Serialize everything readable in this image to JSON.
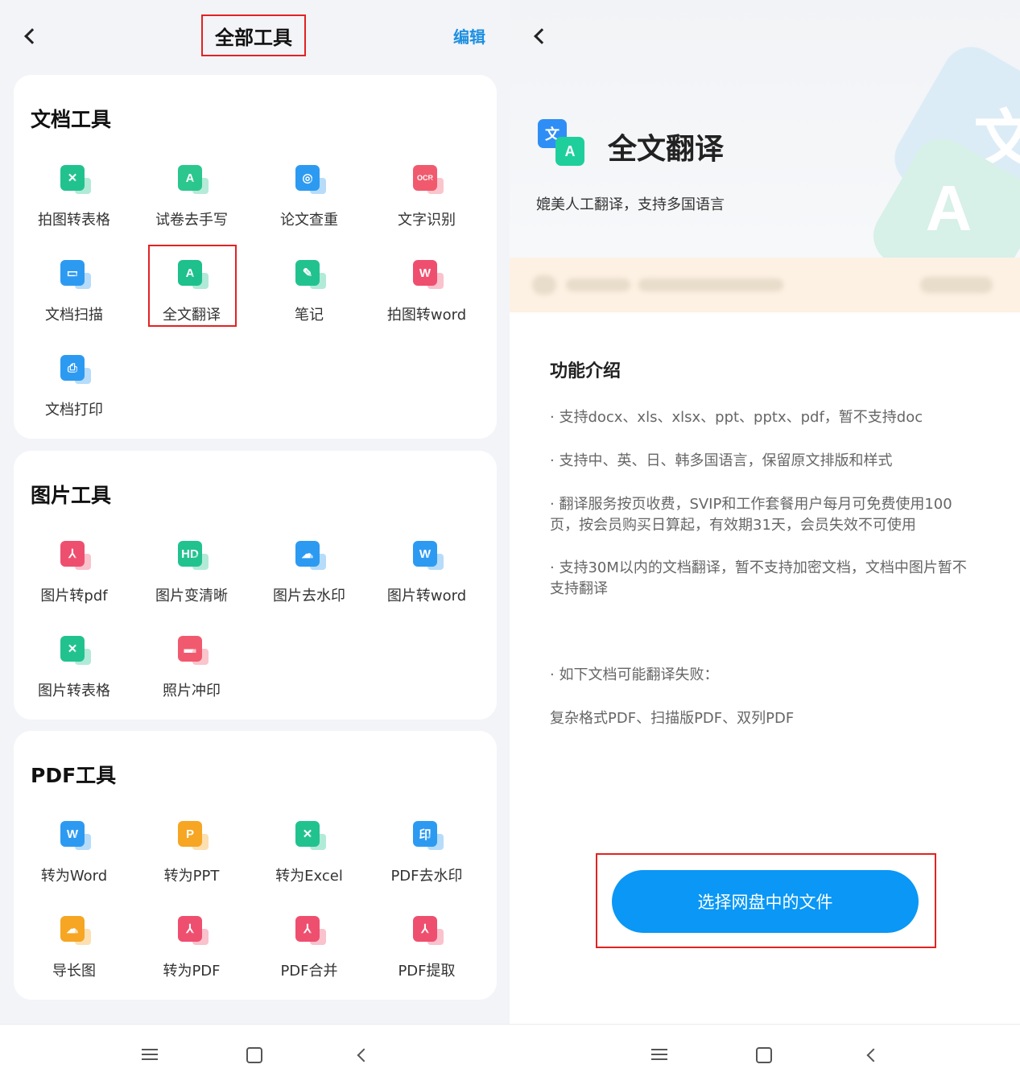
{
  "left": {
    "title": "全部工具",
    "edit_label": "编辑",
    "sections": [
      {
        "title": "文档工具",
        "tools": [
          {
            "label": "拍图转表格",
            "icon": "photo-to-table-icon",
            "color": "#22c28f",
            "glyph": "✕"
          },
          {
            "label": "试卷去手写",
            "icon": "remove-handwriting-icon",
            "color": "#2bc78e",
            "glyph": "A"
          },
          {
            "label": "论文查重",
            "icon": "plagiarism-check-icon",
            "color": "#2d9af2",
            "glyph": "◎"
          },
          {
            "label": "文字识别",
            "icon": "ocr-icon",
            "color": "#f15a6e",
            "glyph": "OCR"
          },
          {
            "label": "文档扫描",
            "icon": "document-scan-icon",
            "color": "#2d9af2",
            "glyph": "▭"
          },
          {
            "label": "全文翻译",
            "icon": "full-text-translate-icon",
            "color": "#1ec08c",
            "glyph": "A"
          },
          {
            "label": "笔记",
            "icon": "notes-icon",
            "color": "#22c28f",
            "glyph": "✎"
          },
          {
            "label": "拍图转word",
            "icon": "photo-to-word-icon",
            "color": "#ef4f6f",
            "glyph": "W"
          },
          {
            "label": "文档打印",
            "icon": "document-print-icon",
            "color": "#2d9af2",
            "glyph": "⎙"
          }
        ]
      },
      {
        "title": "图片工具",
        "tools": [
          {
            "label": "图片转pdf",
            "icon": "image-to-pdf-icon",
            "color": "#ef4f6f",
            "glyph": "⅄"
          },
          {
            "label": "图片变清晰",
            "icon": "image-enhance-icon",
            "color": "#22c28f",
            "glyph": "HD"
          },
          {
            "label": "图片去水印",
            "icon": "image-remove-watermark-icon",
            "color": "#2d9af2",
            "glyph": "☁"
          },
          {
            "label": "图片转word",
            "icon": "image-to-word-icon",
            "color": "#2d9af2",
            "glyph": "W"
          },
          {
            "label": "图片转表格",
            "icon": "image-to-table-icon",
            "color": "#22c28f",
            "glyph": "✕"
          },
          {
            "label": "照片冲印",
            "icon": "photo-print-icon",
            "color": "#f15a6e",
            "glyph": "▬"
          }
        ]
      },
      {
        "title": "PDF工具",
        "tools": [
          {
            "label": "转为Word",
            "icon": "pdf-to-word-icon",
            "color": "#2d9af2",
            "glyph": "W"
          },
          {
            "label": "转为PPT",
            "icon": "pdf-to-ppt-icon",
            "color": "#f6a623",
            "glyph": "P"
          },
          {
            "label": "转为Excel",
            "icon": "pdf-to-excel-icon",
            "color": "#22c28f",
            "glyph": "✕"
          },
          {
            "label": "PDF去水印",
            "icon": "pdf-remove-watermark-icon",
            "color": "#2d9af2",
            "glyph": "印"
          },
          {
            "label": "导长图",
            "icon": "export-long-image-icon",
            "color": "#f6a623",
            "glyph": "☁"
          },
          {
            "label": "转为PDF",
            "icon": "to-pdf-icon",
            "color": "#ef4f6f",
            "glyph": "⅄"
          },
          {
            "label": "PDF合并",
            "icon": "pdf-merge-icon",
            "color": "#ef4f6f",
            "glyph": "⅄"
          },
          {
            "label": "PDF提取",
            "icon": "pdf-extract-icon",
            "color": "#ef4f6f",
            "glyph": "⅄"
          }
        ]
      }
    ]
  },
  "right": {
    "feature_title": "全文翻译",
    "feature_subtitle": "媲美人工翻译，支持多国语言",
    "brand_glyphs": {
      "back": "文",
      "front": "A"
    },
    "intro_title": "功能介绍",
    "bullets": [
      "· 支持docx、xls、xlsx、ppt、pptx、pdf，暂不支持doc",
      "· 支持中、英、日、韩多国语言，保留原文排版和样式",
      "· 翻译服务按页收费，SVIP和工作套餐用户每月可免费使用100页，按会员购买日算起，有效期31天，会员失效不可使用",
      "· 支持30M以内的文档翻译，暂不支持加密文档，文档中图片暂不支持翻译",
      "· 如下文档可能翻译失败：",
      "复杂格式PDF、扫描版PDF、双列PDF"
    ],
    "cta_label": "选择网盘中的文件"
  },
  "colors": {
    "accent": "#0a97f5",
    "highlight": "#e32222",
    "edit": "#1d8fe0"
  }
}
